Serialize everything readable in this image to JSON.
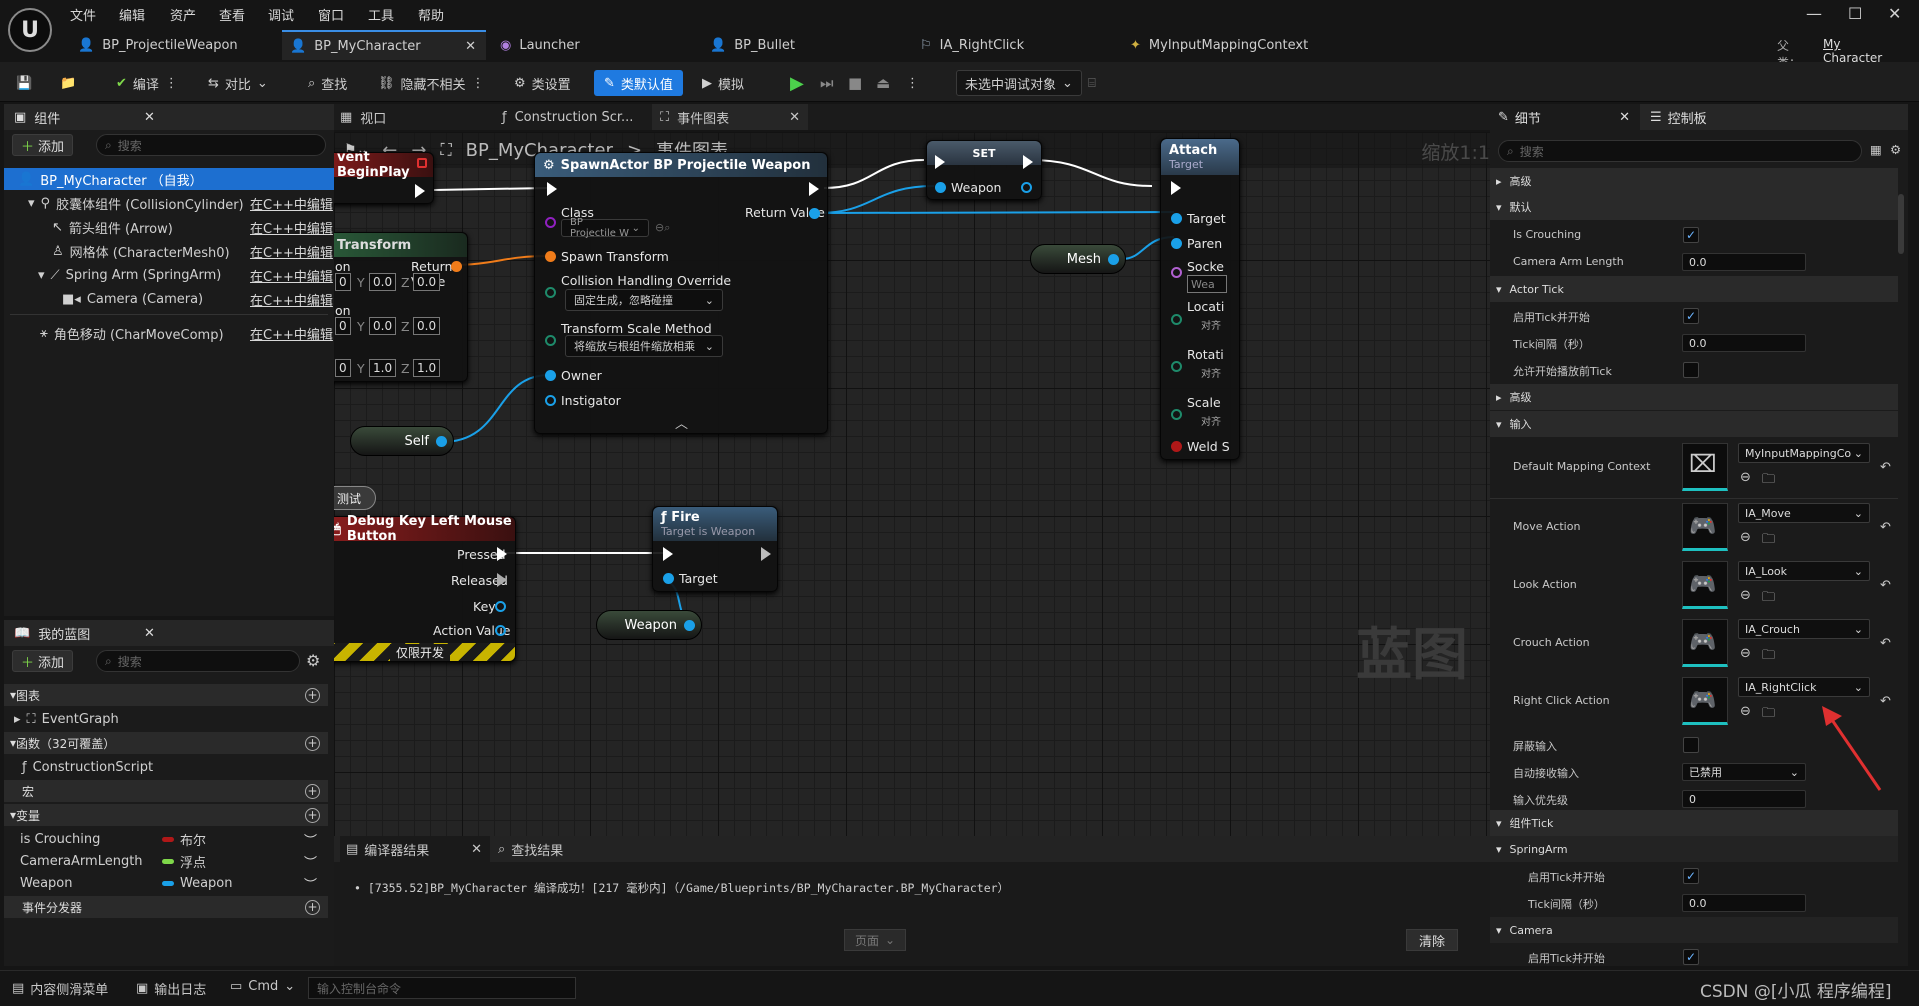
{
  "menubar": {
    "items": [
      "文件",
      "编辑",
      "资产",
      "查看",
      "调试",
      "窗口",
      "工具",
      "帮助"
    ]
  },
  "tabs": [
    {
      "label": "BP_ProjectileWeapon"
    },
    {
      "label": "BP_MyCharacter"
    },
    {
      "label": "Launcher"
    },
    {
      "label": "BP_Bullet"
    },
    {
      "label": "IA_RightClick"
    },
    {
      "label": "MyInputMappingContext"
    }
  ],
  "parent": {
    "label": "父类：",
    "value": "My Character"
  },
  "toolbar": {
    "compile": "编译",
    "diff": "对比",
    "find": "查找",
    "hide_unrelated": "隐藏不相关",
    "class_settings": "类设置",
    "class_defaults": "类默认值",
    "simulate": "模拟",
    "debug_target": "未选中调试对象"
  },
  "components": {
    "title": "组件",
    "add": "添加",
    "search_placeholder": "搜索",
    "items": [
      {
        "label": "BP_MyCharacter （自我）",
        "link": ""
      },
      {
        "label": "胶囊体组件 (CollisionCylinder)",
        "link": "在C++中编辑"
      },
      {
        "label": "箭头组件 (Arrow)",
        "link": "在C++中编辑"
      },
      {
        "label": "网格体 (CharacterMesh0)",
        "link": "在C++中编辑"
      },
      {
        "label": "Spring Arm (SpringArm)",
        "link": "在C++中编辑"
      },
      {
        "label": "Camera (Camera)",
        "link": "在C++中编辑"
      },
      {
        "label": "角色移动 (CharMoveComp)",
        "link": "在C++中编辑"
      }
    ]
  },
  "mybp": {
    "title": "我的蓝图",
    "add": "添加",
    "search_placeholder": "搜索",
    "graphs": "图表",
    "eventgraph": "EventGraph",
    "functions": "函数（32可覆盖）",
    "construction": "ConstructionScript",
    "macros": "宏",
    "variables": "变量",
    "vars": [
      {
        "name": "is Crouching",
        "type": "布尔",
        "color": "#b01818"
      },
      {
        "name": "CameraArmLength",
        "type": "浮点",
        "color": "#7fd84a"
      },
      {
        "name": "Weapon",
        "type": "Weapon",
        "color": "#1aa0e8"
      }
    ],
    "dispatchers": "事件分发器"
  },
  "graphtabs": {
    "viewport": "视口",
    "construction": "Construction Scr...",
    "eventgraph": "事件图表"
  },
  "breadcrumb": {
    "bp": "BP_MyCharacter",
    "sep": ">",
    "graph": "事件图表",
    "zoom": "缩放1:1"
  },
  "nodes": {
    "beginplay": "vent BeginPlay",
    "transform": {
      "title": "Transform",
      "return": "Return Value",
      "lbl_on": "on",
      "vals": [
        [
          "0",
          "0.0",
          "0.0"
        ],
        [
          "0",
          "0.0",
          "0.0"
        ],
        [
          "0",
          "1.0",
          "1.0"
        ]
      ]
    },
    "spawn": {
      "title": "SpawnActor BP Projectile Weapon",
      "class": "Class",
      "class_val": "BP Projectile W",
      "return": "Return Value",
      "spawn_transform": "Spawn Transform",
      "collision": "Collision Handling Override",
      "collision_val": "固定生成，忽略碰撞",
      "scale": "Transform Scale Method",
      "scale_val": "将缩放与根组件缩放相乘",
      "owner": "Owner",
      "instigator": "Instigator"
    },
    "set": {
      "title": "SET",
      "weapon": "Weapon"
    },
    "attach": {
      "title": "Attach",
      "sub": "Target",
      "pins": [
        "Target",
        "Paren",
        "Socke",
        "Wea",
        "Locati",
        "对齐",
        "Rotati",
        "对齐",
        "Scale",
        "对齐",
        "Weld S"
      ]
    },
    "mesh": "Mesh",
    "self": "Self",
    "debug": {
      "badge": "测试",
      "title": "Debug Key Left Mouse Button",
      "pressed": "Pressed",
      "released": "Released",
      "key": "Key",
      "action": "Action Value",
      "devonly": "仅限开发"
    },
    "fire": {
      "title": "Fire",
      "sub": "Target is Weapon",
      "target": "Target"
    },
    "weaponvar": "Weapon",
    "watermark": "蓝图"
  },
  "compiler": {
    "tab": "编译器结果",
    "find": "查找结果",
    "message": "[7355.52]BP_MyCharacter 编译成功！[217 毫秒内]（/Game/Blueprints/BP_MyCharacter.BP_MyCharacter）",
    "page": "页面",
    "clear": "清除"
  },
  "statusbar": {
    "drawer": "内容侧滑菜单",
    "output": "输出日志",
    "cmd": "Cmd",
    "console_placeholder": "输入控制台命令",
    "watermark": "CSDN @[小瓜 程序编程]"
  },
  "details": {
    "tab": "细节",
    "tab2": "控制板",
    "search_placeholder": "搜索",
    "adv": "高级",
    "default": "默认",
    "is_crouching": "Is Crouching",
    "cam_arm": "Camera Arm Length",
    "cam_arm_val": "0.0",
    "actor_tick": "Actor Tick",
    "tick_enable": "启用Tick并开始",
    "tick_interval": "Tick间隔（秒）",
    "tick_interval_val": "0.0",
    "tick_before": "允许开始播放前Tick",
    "adv2": "高级",
    "input": "输入",
    "mapping": "Default Mapping Context",
    "mapping_val": "MyInputMappingCo",
    "move": "Move Action",
    "move_val": "IA_Move",
    "look": "Look Action",
    "look_val": "IA_Look",
    "crouch": "Crouch Action",
    "crouch_val": "IA_Crouch",
    "right": "Right Click Action",
    "right_val": "IA_RightClick",
    "block": "屏蔽输入",
    "auto_recv": "自动接收输入",
    "auto_recv_val": "已禁用",
    "priority": "输入优先级",
    "priority_val": "0",
    "comp_tick": "组件Tick",
    "springarm": "SpringArm",
    "sa_tick": "启用Tick并开始",
    "sa_interval": "Tick间隔（秒）",
    "sa_interval_val": "0.0",
    "camera": "Camera",
    "cam_tick": "启用Tick并开始"
  },
  "colors": {
    "accent": "#1f7ae0",
    "exec": "#ffffff",
    "object_pin": "#1aa0e8",
    "transform_pin": "#f07c1a",
    "red_arrow": "#e03030"
  }
}
